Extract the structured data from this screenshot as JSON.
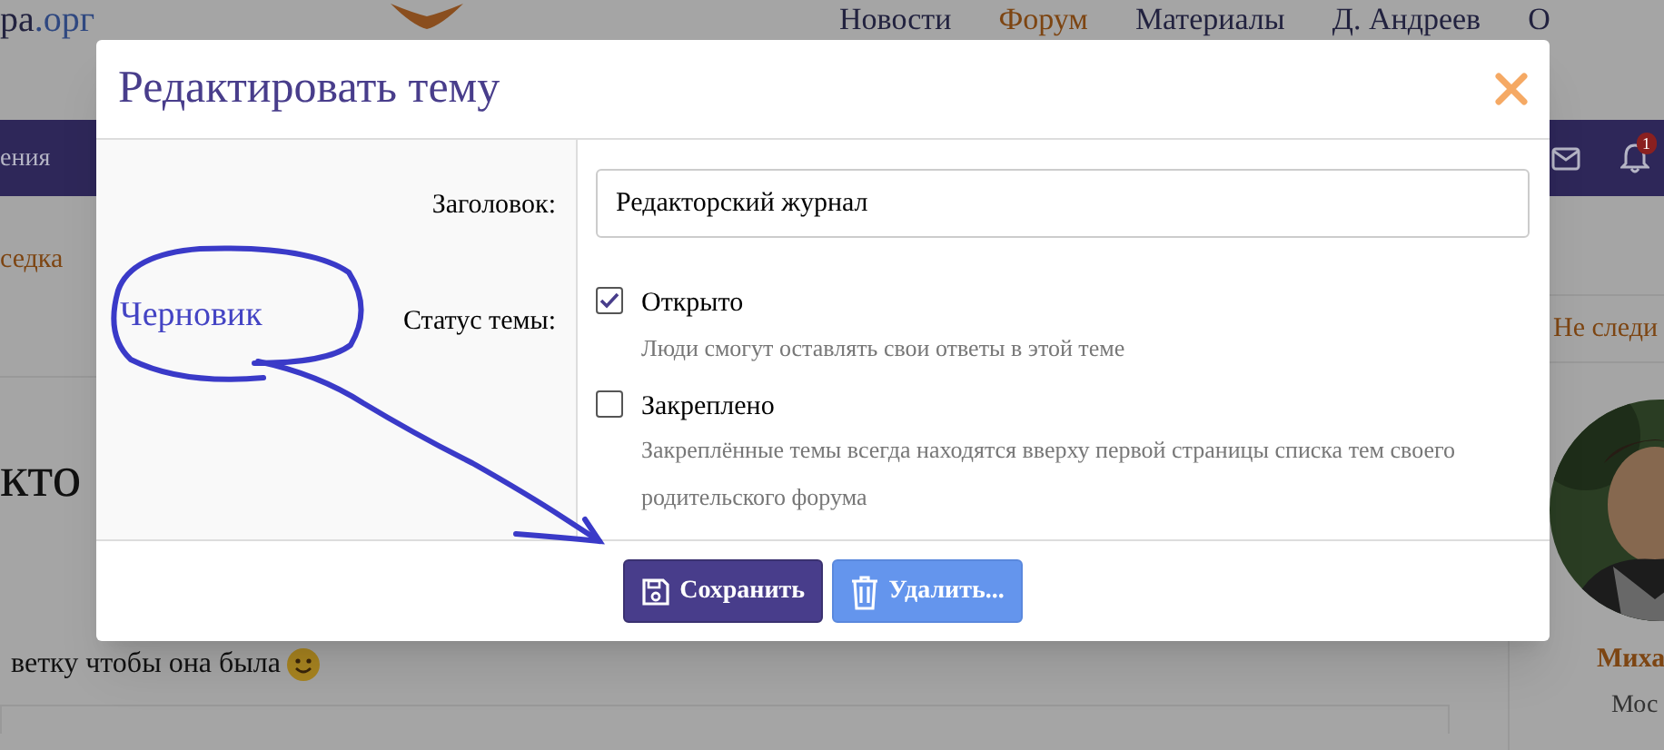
{
  "site": {
    "logo_text": "ра",
    "logo_domain": ".орг",
    "nav": [
      {
        "label": "Новости",
        "selected": false
      },
      {
        "label": "Форум",
        "selected": true
      },
      {
        "label": "Материалы",
        "selected": false
      },
      {
        "label": "Д. Андреев",
        "selected": false
      },
      {
        "label": "О",
        "selected": false
      }
    ]
  },
  "subnav": {
    "items": [
      "ения"
    ],
    "notification_count": "1"
  },
  "breadcrumb": "седка",
  "topic_heading": "кто",
  "post_text": "ветку чтобы она была",
  "sidebar": {
    "follow": "Не следи",
    "user_name": "Миха",
    "user_location": "Мос"
  },
  "modal": {
    "title": "Редактировать тему",
    "fields": [
      {
        "label": "Заголовок:",
        "value": "Редакторский журнал"
      }
    ],
    "status_label": "Статус темы:",
    "options": [
      {
        "label": "Открыто",
        "description": "Люди смогут оставлять свои ответы в этой теме",
        "checked": true
      },
      {
        "label": "Закреплено",
        "description": "Закреплённые темы всегда находятся вверху первой страницы списка тем своего родительского форума",
        "checked": false
      }
    ],
    "buttons": [
      {
        "label": "Сохранить",
        "kind": "primary"
      },
      {
        "label": "Удалить...",
        "kind": "danger"
      }
    ]
  },
  "annotation": {
    "text": "Черновик"
  }
}
